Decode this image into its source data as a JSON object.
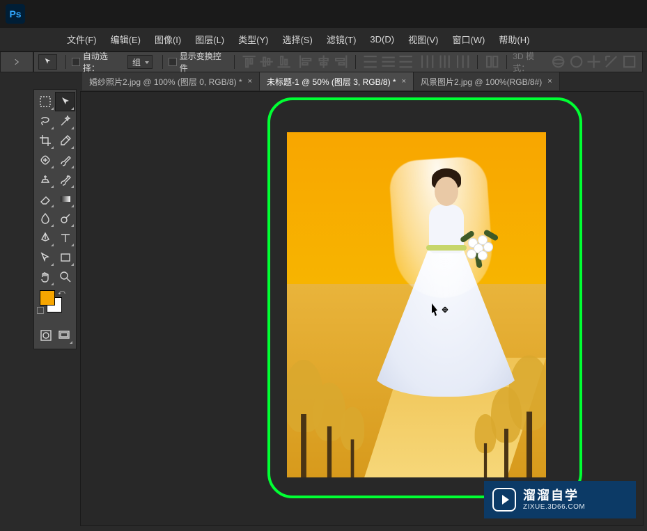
{
  "app": {
    "logo": "Ps"
  },
  "menu": {
    "file": "文件(F)",
    "edit": "编辑(E)",
    "image": "图像(I)",
    "layer": "图层(L)",
    "type": "类型(Y)",
    "select": "选择(S)",
    "filter": "滤镜(T)",
    "threeD": "3D(D)",
    "view": "视图(V)",
    "window": "窗口(W)",
    "help": "帮助(H)"
  },
  "options": {
    "auto_select": "自动选择：",
    "group": "组",
    "show_transform": "显示变换控件",
    "mode3d": "3D 模式："
  },
  "tabs": [
    {
      "label": "婚纱照片2.jpg @ 100% (图层 0, RGB/8) *",
      "active": false
    },
    {
      "label": "未标题-1 @ 50% (图层 3, RGB/8) *",
      "active": true
    },
    {
      "label": "风景图片2.jpg @ 100%(RGB/8#)",
      "active": false
    }
  ],
  "swatch": {
    "fg": "#f7a600",
    "bg": "#ffffff"
  },
  "watermark": {
    "cn": "溜溜自学",
    "en": "ZIXUE.3D66.COM"
  }
}
